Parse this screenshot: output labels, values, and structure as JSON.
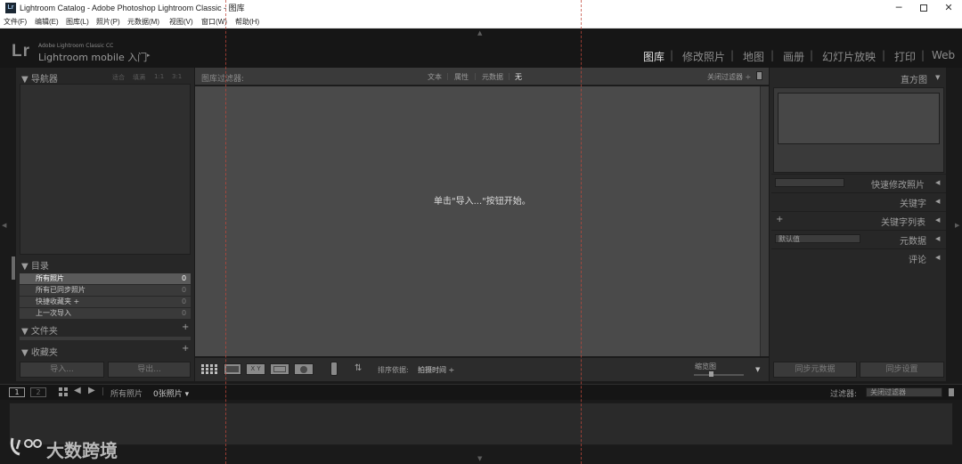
{
  "window": {
    "title": "Lightroom Catalog - Adobe Photoshop Lightroom Classic - 图库",
    "app_icon": "Lr",
    "controls": [
      "minimize-icon",
      "maximize-icon",
      "close-icon"
    ]
  },
  "menu": [
    "文件(F)",
    "编辑(E)",
    "图库(L)",
    "照片(P)",
    "元数据(M)",
    "视图(V)",
    "窗口(W)",
    "帮助(H)"
  ],
  "identity": {
    "logo": "Lr",
    "small": "Adobe Lightroom Classic CC",
    "main": "Lightroom mobile 入门",
    "arrow": "▸"
  },
  "modules": [
    {
      "label": "图库",
      "active": true
    },
    {
      "label": "修改照片"
    },
    {
      "label": "地图"
    },
    {
      "label": "画册"
    },
    {
      "label": "幻灯片放映"
    },
    {
      "label": "打印"
    },
    {
      "label": "Web"
    }
  ],
  "module_separator": "|",
  "left_panel": {
    "navigator": {
      "title": "▼ 导航器",
      "options": [
        "适合",
        "填满",
        "1:1",
        "3:1"
      ]
    },
    "catalog": {
      "title": "▼ 目录",
      "rows": [
        {
          "label": "所有照片",
          "count": "0",
          "selected": true
        },
        {
          "label": "所有已同步照片",
          "count": "0"
        },
        {
          "label": "快捷收藏夹 +",
          "count": "0"
        },
        {
          "label": "上一次导入",
          "count": "0"
        }
      ]
    },
    "folders": {
      "title": "▼ 文件夹",
      "add": "+"
    },
    "collections": {
      "title": "▼ 收藏夹",
      "add": "+"
    },
    "import_label": "导入...",
    "export_label": "导出..."
  },
  "filter_bar": {
    "title": "图库过滤器:",
    "options": [
      "文本",
      "属性",
      "元数据",
      "无"
    ],
    "active_option": "无",
    "preset": "关闭过滤器 ÷"
  },
  "grid": {
    "empty_message": "单击\"导入...\"按钮开始。"
  },
  "toolbar": {
    "sort_label": "排序依据:",
    "sort_value": "拍摄时间 ÷",
    "thumb_label": "缩览图",
    "view_icons": [
      "grid-view-icon",
      "loupe-view-icon",
      "compare-view-icon",
      "survey-view-icon",
      "people-view-icon"
    ]
  },
  "right_panel": {
    "histogram": "直方图",
    "quick_develop": "快速修改照片",
    "keywording": "关键字",
    "keyword_list": "关键字列表",
    "keyword_add": "+",
    "metadata": "元数据",
    "metadata_preset": "默认值",
    "comments": "评论",
    "sync_metadata": "同步元数据",
    "sync_settings": "同步设置"
  },
  "filmstrip": {
    "monitor1": "1",
    "monitor2": "2",
    "source": "所有照片",
    "count": "0张照片 ▾",
    "filter_label": "过滤器:",
    "filter_value": "关闭过滤器"
  },
  "watermark": {
    "text": "大数跨境"
  }
}
